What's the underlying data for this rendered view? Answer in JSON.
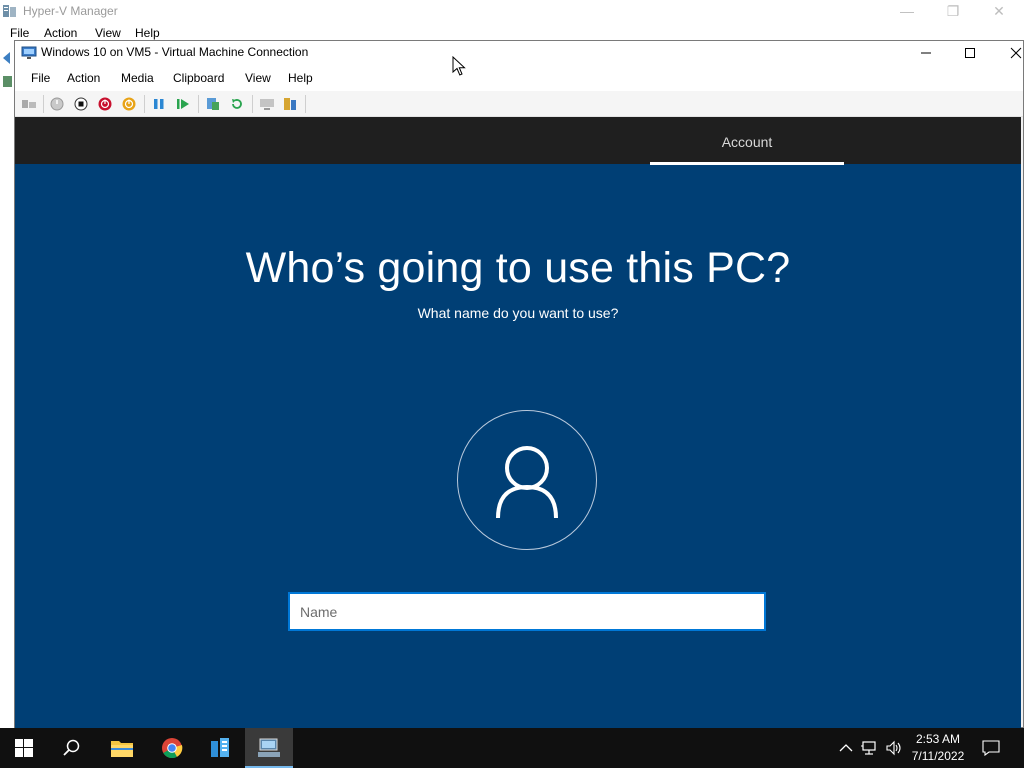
{
  "background_window": {
    "title": "Hyper-V Manager",
    "menu": [
      "File",
      "Action",
      "View",
      "Help"
    ]
  },
  "vm_window": {
    "title": "Windows 10 on VM5 - Virtual Machine Connection",
    "menu": [
      "File",
      "Action",
      "Media",
      "Clipboard",
      "View",
      "Help"
    ],
    "toolbar_icons": [
      "ctrl-alt-del-icon",
      "start-icon",
      "turn-off-icon",
      "shut-down-icon",
      "save-icon",
      "pause-icon",
      "resume-icon",
      "checkpoint-icon",
      "revert-icon",
      "enhanced-session-icon",
      "share-icon"
    ]
  },
  "oobe": {
    "step_label": "Account",
    "heading": "Who’s going to use this PC?",
    "subheading": "What name do you want to use?",
    "name_placeholder": "Name",
    "name_value": ""
  },
  "taskbar": {
    "items": [
      "start-icon",
      "search-icon",
      "file-explorer-icon",
      "chrome-icon",
      "server-manager-icon",
      "hyper-v-manager-icon"
    ],
    "active_item": "hyper-v-manager-icon",
    "clock_time": "2:53 AM",
    "clock_date": "7/11/2022"
  },
  "colors": {
    "oobe_blue": "#003f75",
    "oobe_header": "#1f1f1f",
    "input_border": "#0078d7",
    "taskbar": "#101010"
  }
}
